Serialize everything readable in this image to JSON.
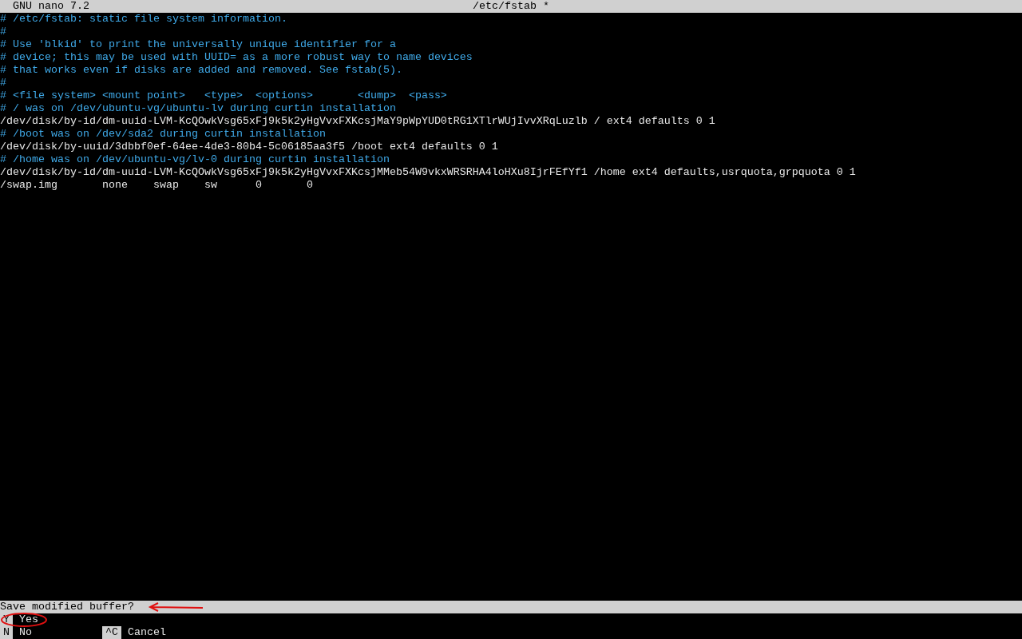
{
  "title_bar": {
    "app": "GNU nano 7.2",
    "file": "/etc/fstab *"
  },
  "lines": [
    {
      "kind": "comment",
      "text": "# /etc/fstab: static file system information."
    },
    {
      "kind": "comment",
      "text": "#"
    },
    {
      "kind": "comment",
      "text": "# Use 'blkid' to print the universally unique identifier for a"
    },
    {
      "kind": "comment",
      "text": "# device; this may be used with UUID= as a more robust way to name devices"
    },
    {
      "kind": "comment",
      "text": "# that works even if disks are added and removed. See fstab(5)."
    },
    {
      "kind": "comment",
      "text": "#"
    },
    {
      "kind": "comment",
      "text": "# <file system> <mount point>   <type>  <options>       <dump>  <pass>"
    },
    {
      "kind": "comment",
      "text": "# / was on /dev/ubuntu-vg/ubuntu-lv during curtin installation"
    },
    {
      "kind": "data",
      "text": "/dev/disk/by-id/dm-uuid-LVM-KcQOwkVsg65xFj9k5k2yHgVvxFXKcsjMaY9pWpYUD0tRG1XTlrWUjIvvXRqLuzlb / ext4 defaults 0 1"
    },
    {
      "kind": "comment",
      "text": "# /boot was on /dev/sda2 during curtin installation"
    },
    {
      "kind": "data",
      "text": "/dev/disk/by-uuid/3dbbf0ef-64ee-4de3-80b4-5c06185aa3f5 /boot ext4 defaults 0 1"
    },
    {
      "kind": "comment",
      "text": "# /home was on /dev/ubuntu-vg/lv-0 during curtin installation"
    },
    {
      "kind": "data",
      "text": "/dev/disk/by-id/dm-uuid-LVM-KcQOwkVsg65xFj9k5k2yHgVvxFXKcsjMMeb54W9vkxWRSRHA4loHXu8IjrFEfYf1 /home ext4 defaults,usrquota,grpquota 0 1"
    },
    {
      "kind": "data",
      "text": "/swap.img       none    swap    sw      0       0"
    }
  ],
  "prompt": "Save modified buffer?",
  "shortcut_rows": [
    [
      {
        "key": "Y",
        "label": "Yes"
      }
    ],
    [
      {
        "key": "N",
        "label": "No"
      },
      {
        "key": "^C",
        "label": "Cancel"
      }
    ]
  ]
}
